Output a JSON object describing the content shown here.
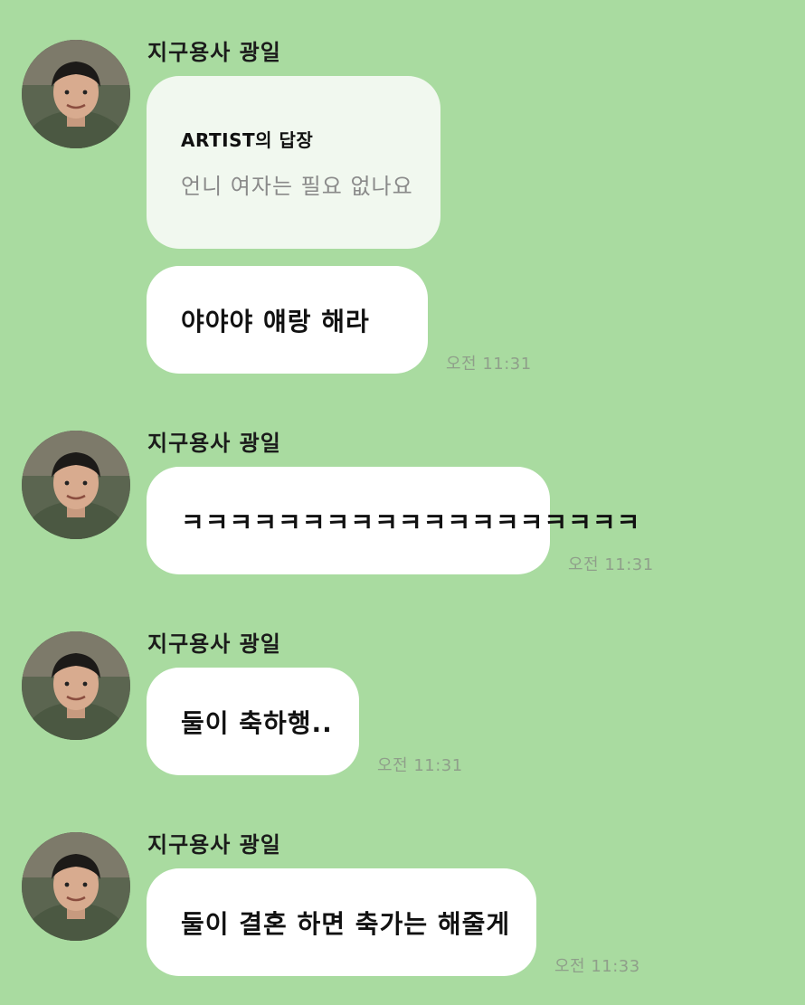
{
  "messages": [
    {
      "sender": "지구용사 광일",
      "reply": {
        "title": "ARTIST의 답장",
        "text": "언니 여자는 필요 없나요"
      },
      "text": "야야야 얘랑 해라",
      "time": "오전 11:31"
    },
    {
      "sender": "지구용사 광일",
      "text": "ㅋㅋㅋㅋㅋㅋㅋㅋㅋㅋㅋㅋㅋㅋㅋㅋㅋㅋㅋ",
      "time": "오전 11:31"
    },
    {
      "sender": "지구용사 광일",
      "text": "둘이 축하행..",
      "time": "오전 11:31"
    },
    {
      "sender": "지구용사 광일",
      "text": "둘이 결혼 하면 축가는 해줄게",
      "time": "오전 11:33"
    }
  ],
  "colors": {
    "background": "#a9dba0",
    "bubble": "#ffffff",
    "reply_bubble": "#f1f8ef",
    "timestamp": "#8f9f8a"
  },
  "icons": {
    "avatar": "profile-photo"
  }
}
